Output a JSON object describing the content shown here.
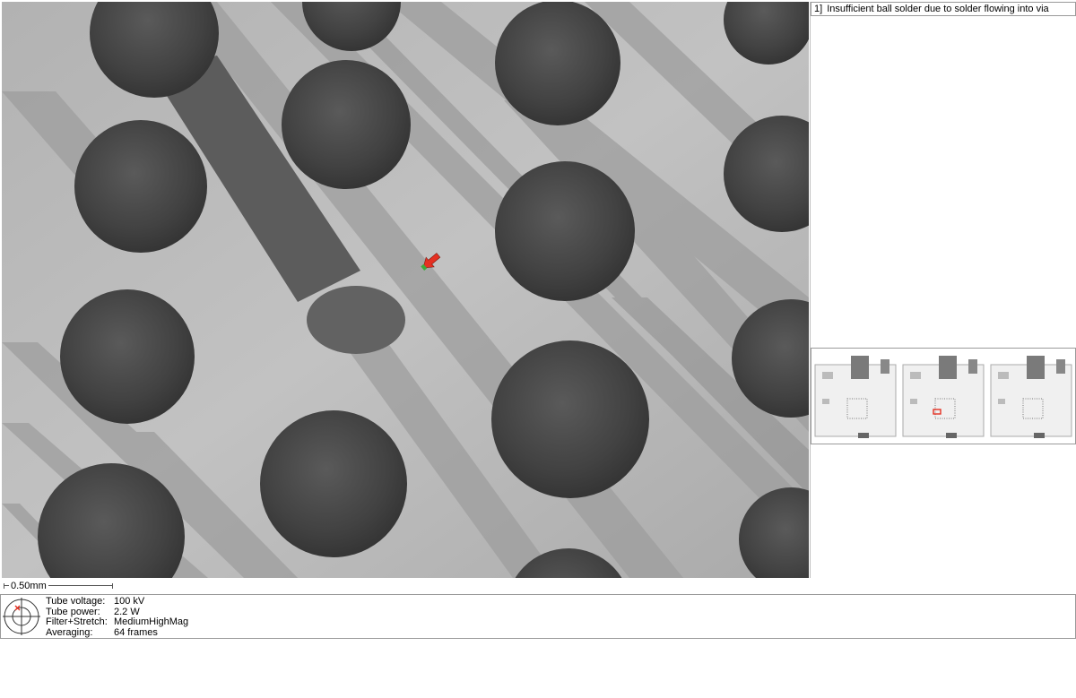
{
  "annotation": {
    "number": "1]",
    "text": "Insufficient ball solder due to solder flowing into via"
  },
  "scale": {
    "label": "0.50mm"
  },
  "parameters": [
    {
      "label": "Tube voltage:",
      "value": "100 kV"
    },
    {
      "label": "Tube power:",
      "value": "2.2 W"
    },
    {
      "label": "Filter+Stretch:",
      "value": "MediumHighMag"
    },
    {
      "label": "Averaging:",
      "value": "64 frames"
    }
  ],
  "icons": {
    "position_indicator": "crosshair-icon",
    "defect_marker": "red-arrow-icon"
  },
  "colors": {
    "marker": "#e53022",
    "marker_tip": "#3caa3c",
    "highlight": "#e53022"
  },
  "thumbnails": {
    "count": 3,
    "highlighted_index": 1
  }
}
